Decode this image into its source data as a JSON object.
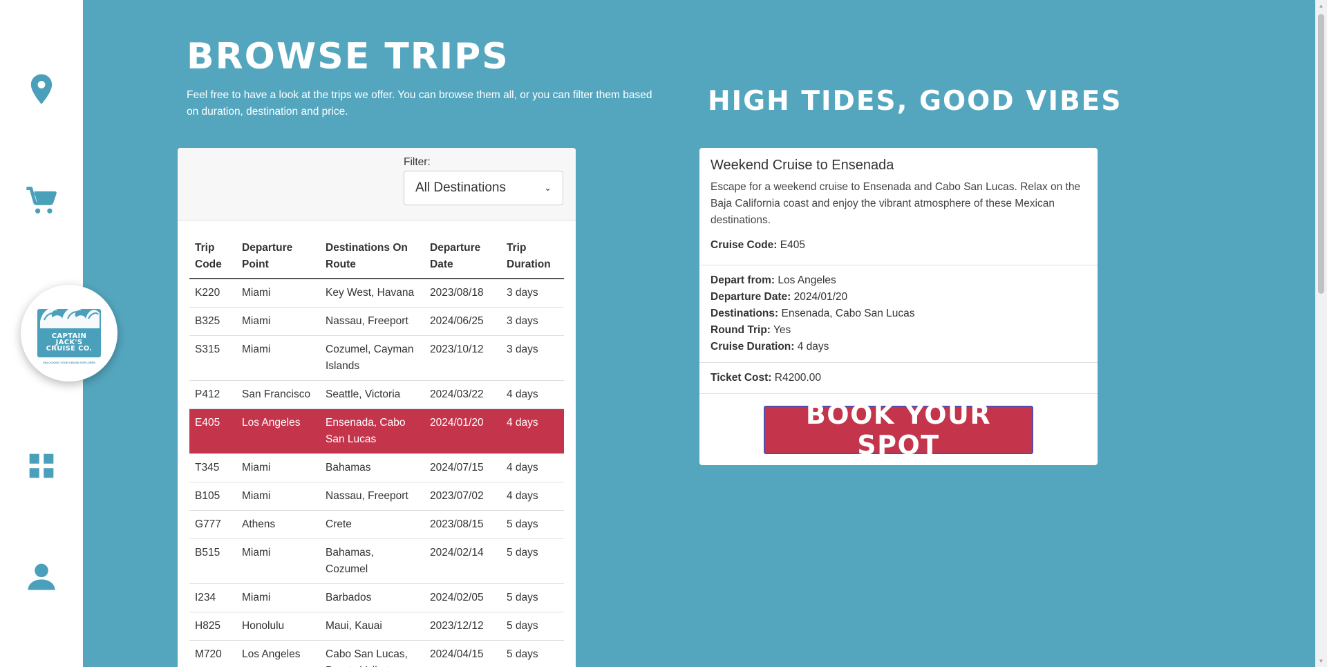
{
  "colors": {
    "background": "#54a6bf",
    "accent": "#c4344b",
    "icon": "#4a9fbb",
    "panel": "#ffffff"
  },
  "sidebar": {
    "icons": [
      "location-pin-icon",
      "cart-icon",
      "grid-icon",
      "user-icon"
    ],
    "logo": {
      "line1": "CAPTAIN",
      "line2": "JACK'S",
      "line3": "CRUISE CO.",
      "tagline": "UNLOCKING YOUR CRUISE EXPLORER"
    }
  },
  "header": {
    "title": "Browse Trips",
    "intro": "Feel free to have a look at the trips we offer. You can browse them all, or you can filter them based on duration, destination and price.",
    "tagline": "High Tides, Good Vibes"
  },
  "filter": {
    "label": "Filter:",
    "selected": "All Destinations"
  },
  "table": {
    "headers": [
      "Trip Code",
      "Departure Point",
      "Destinations On Route",
      "Departure Date",
      "Trip Duration"
    ],
    "rows": [
      [
        "K220",
        "Miami",
        "Key West, Havana",
        "2023/08/18",
        "3 days"
      ],
      [
        "B325",
        "Miami",
        "Nassau, Freeport",
        "2024/06/25",
        "3 days"
      ],
      [
        "S315",
        "Miami",
        "Cozumel, Cayman Islands",
        "2023/10/12",
        "3 days"
      ],
      [
        "P412",
        "San Francisco",
        "Seattle, Victoria",
        "2024/03/22",
        "4 days"
      ],
      [
        "E405",
        "Los Angeles",
        "Ensenada, Cabo San Lucas",
        "2024/01/20",
        "4 days"
      ],
      [
        "T345",
        "Miami",
        "Bahamas",
        "2024/07/15",
        "4 days"
      ],
      [
        "B105",
        "Miami",
        "Nassau, Freeport",
        "2023/07/02",
        "4 days"
      ],
      [
        "G777",
        "Athens",
        "Crete",
        "2023/08/15",
        "5 days"
      ],
      [
        "B515",
        "Miami",
        "Bahamas, Cozumel",
        "2024/02/14",
        "5 days"
      ],
      [
        "I234",
        "Miami",
        "Barbados",
        "2024/02/05",
        "5 days"
      ],
      [
        "H825",
        "Honolulu",
        "Maui, Kauai",
        "2023/12/12",
        "5 days"
      ],
      [
        "M720",
        "Los Angeles",
        "Cabo San Lucas, Puerto Vallarta",
        "2024/04/15",
        "5 days"
      ]
    ],
    "selected_code": "E405"
  },
  "detail": {
    "title": "Weekend Cruise to Ensenada",
    "description": "Escape for a weekend cruise to Ensenada and Cabo San Lucas. Relax on the Baja California coast and enjoy the vibrant atmosphere of these Mexican destinations.",
    "cruise_code_label": "Cruise Code:",
    "cruise_code": "E405",
    "depart_label": "Depart from:",
    "depart": "Los Angeles",
    "date_label": "Departure Date:",
    "date": "2024/01/20",
    "destinations_label": "Destinations:",
    "destinations": "Ensenada, Cabo San Lucas",
    "round_trip_label": "Round Trip:",
    "round_trip": "Yes",
    "duration_label": "Cruise Duration:",
    "duration": "4 days",
    "cost_label": "Ticket Cost:",
    "cost": "R4200.00",
    "book_label": "Book Your Spot"
  }
}
